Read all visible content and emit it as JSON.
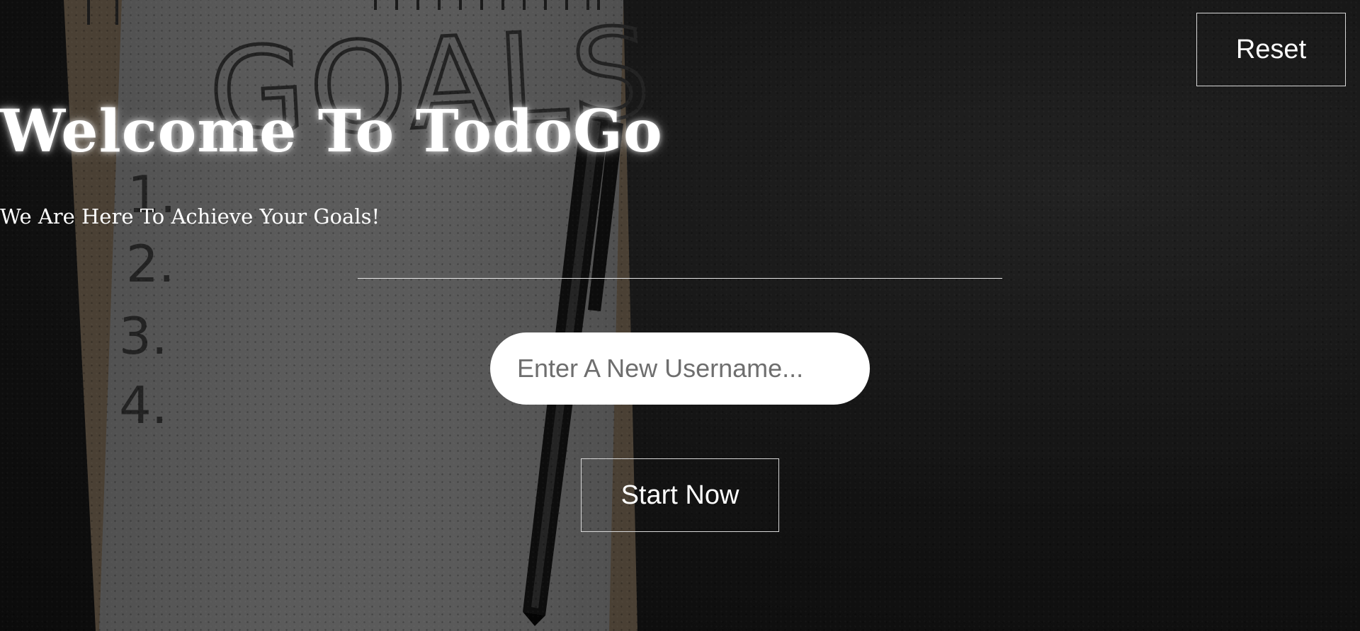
{
  "header": {
    "reset_label": "Reset"
  },
  "hero": {
    "title": "Welcome To TodoGo",
    "subtitle": "We Are Here To Achieve Your Goals!"
  },
  "form": {
    "username_placeholder": "Enter A New Username...",
    "username_value": "",
    "start_label": "Start Now"
  },
  "background": {
    "notebook_heading": "GOALS",
    "notebook_list": [
      "1.",
      "2.",
      "3.",
      "4."
    ],
    "icons": [
      "notebook-illustration",
      "pen-illustration"
    ]
  }
}
